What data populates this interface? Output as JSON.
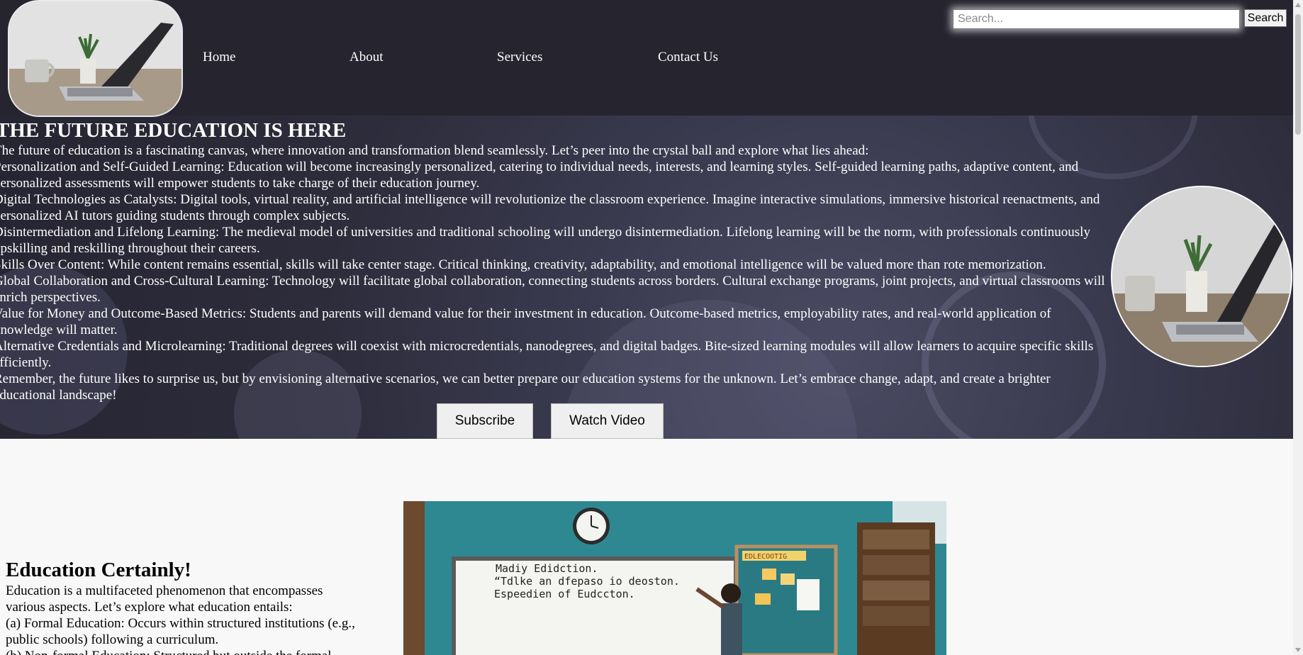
{
  "header": {
    "nav": [
      "Home",
      "About",
      "Services",
      "Contact Us"
    ],
    "search": {
      "placeholder": "Search...",
      "button_label": "Search"
    }
  },
  "hero": {
    "title": "THE FUTURE EDUCATION IS HERE",
    "paragraphs": [
      "The future of education is a fascinating canvas, where innovation and transformation blend seamlessly. Let’s peer into the crystal ball and explore what lies ahead:",
      "Personalization and Self-Guided Learning: Education will become increasingly personalized, catering to individual needs, interests, and learning styles. Self-guided learning paths, adaptive content, and personalized assessments will empower students to take charge of their education journey.",
      "Digital Technologies as Catalysts: Digital tools, virtual reality, and artificial intelligence will revolutionize the classroom experience. Imagine interactive simulations, immersive historical reenactments, and personalized AI tutors guiding students through complex subjects.",
      "Disintermediation and Lifelong Learning: The medieval model of universities and traditional schooling will undergo disintermediation. Lifelong learning will be the norm, with professionals continuously upskilling and reskilling throughout their careers.",
      "Skills Over Content: While content remains essential, skills will take center stage. Critical thinking, creativity, adaptability, and emotional intelligence will be valued more than rote memorization.",
      "Global Collaboration and Cross-Cultural Learning: Technology will facilitate global collaboration, connecting students across borders. Cultural exchange programs, joint projects, and virtual classrooms will enrich perspectives.",
      "Value for Money and Outcome-Based Metrics: Students and parents will demand value for their investment in education. Outcome-based metrics, employability rates, and real-world application of knowledge will matter.",
      "Alternative Credentials and Microlearning: Traditional degrees will coexist with microcredentials, nanodegrees, and digital badges. Bite-sized learning modules will allow learners to acquire specific skills efficiently.",
      "Remember, the future likes to surprise us, but by envisioning alternative scenarios, we can better prepare our education systems for the unknown. Let’s embrace change, adapt, and create a brighter educational landscape!"
    ],
    "subscribe_label": "Subscribe",
    "watch_label": "Watch Video"
  },
  "education": {
    "title": "Education Certainly!",
    "lines": [
      "Education is a multifaceted phenomenon that encompasses various aspects. Let’s explore what education entails:",
      "(a) Formal Education: Occurs within structured institutions (e.g., public schools) following a curriculum.",
      "(b) Non-formal Education: Structured but outside the formal"
    ],
    "board_text": [
      "Madiy Edidction.",
      "“Tdlke an dfepaso io deoston.",
      "Espeedien of Eudccton."
    ],
    "board_sign": "EDLECOOTIG"
  },
  "icons": [
    "laptop-logo-image",
    "laptop-photo",
    "classroom-photo"
  ]
}
